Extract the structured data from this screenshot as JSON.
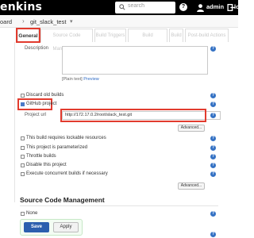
{
  "header": {
    "brand": "enkins",
    "search_placeholder": "search",
    "help_glyph": "?",
    "username": "admin",
    "logout_fragment": "lo",
    "icons": [
      "search-icon",
      "help-icon",
      "user-icon",
      "logout-icon"
    ]
  },
  "breadcrumb": {
    "items": [
      "oard",
      "git_slack_test"
    ],
    "separator": "›",
    "dropdown_glyph": "▾"
  },
  "tabs": [
    {
      "label": "General",
      "active": true
    },
    {
      "label": "Source Code Management",
      "active": false
    },
    {
      "label": "Build Triggers",
      "active": false
    },
    {
      "label": "Build Environment",
      "active": false
    },
    {
      "label": "Build",
      "active": false
    },
    {
      "label": "Post-build Actions",
      "active": false
    }
  ],
  "general": {
    "description_label": "Description",
    "preview_prefix": "[Plain text]",
    "preview_link": "Preview",
    "options": [
      {
        "label": "Discard old builds",
        "checked": false
      },
      {
        "label": "GitHub project",
        "checked": true
      },
      {
        "label": "This build requires lockable resources",
        "checked": false
      },
      {
        "label": "This project is parameterized",
        "checked": false
      },
      {
        "label": "Throttle builds",
        "checked": false
      },
      {
        "label": "Disable this project",
        "checked": false
      },
      {
        "label": "Execute concurrent builds if necessary",
        "checked": false
      }
    ],
    "project_url_label": "Project url",
    "project_url_value": "http://172.17.0.2/root/slack_test.git",
    "advanced_label": "Advanced..."
  },
  "scm": {
    "section_title": "Source Code Management",
    "none_label": "None"
  },
  "footer": {
    "save_label": "Save",
    "apply_label": "Apply"
  },
  "colors": {
    "header_bg": "#000000",
    "highlight": "#e23b2e",
    "primary_button": "#2c5fae",
    "help_icon": "#3572c4"
  }
}
